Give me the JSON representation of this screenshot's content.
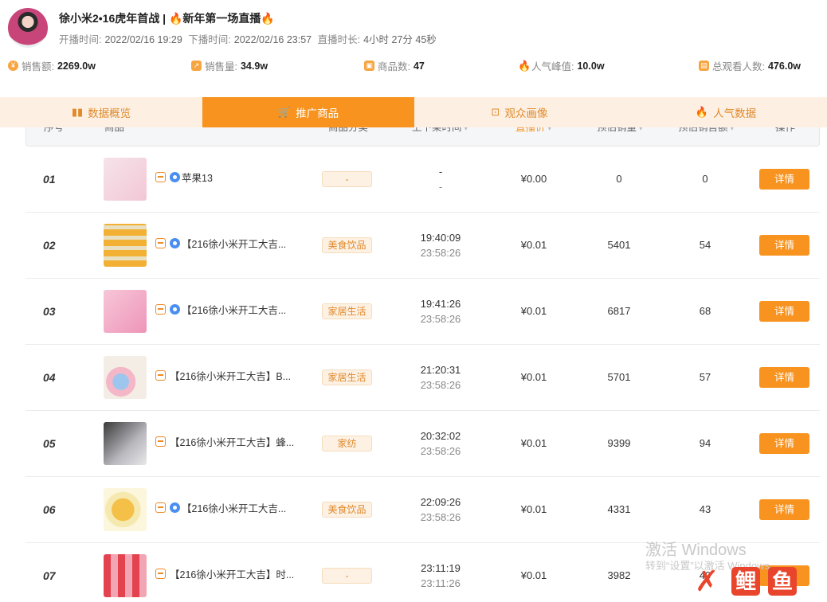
{
  "stream": {
    "title": "徐小米2•16虎年首战 |",
    "title_suffix": "新年第一场直播",
    "start_label": "开播时间:",
    "start_value": "2022/02/16 19:29",
    "end_label": "下播时间:",
    "end_value": "2022/02/16 23:57",
    "duration_label": "直播时长:",
    "duration_value": "4小时 27分 45秒"
  },
  "stats": [
    {
      "label": "销售额:",
      "value": "2269.0w",
      "icon": "coin-icon"
    },
    {
      "label": "销售量:",
      "value": "34.9w",
      "icon": "trend-chart-icon"
    },
    {
      "label": "商品数:",
      "value": "47",
      "icon": "bag-icon"
    },
    {
      "label": "人气峰值:",
      "value": "10.0w",
      "icon": "flame-icon"
    },
    {
      "label": "总观看人数:",
      "value": "476.0w",
      "icon": "gift-icon"
    }
  ],
  "tabs": [
    {
      "label": "数据概览",
      "icon": "bar-chart-icon",
      "active": false
    },
    {
      "label": "推广商品",
      "icon": "basket-icon",
      "active": true
    },
    {
      "label": "观众画像",
      "icon": "scan-icon",
      "active": false
    },
    {
      "label": "人气数据",
      "icon": "flame-icon",
      "active": false
    }
  ],
  "table": {
    "headers": {
      "index": "序号",
      "product": "商品",
      "category": "商品分类",
      "time": "上下架时间",
      "price": "直播价",
      "sales": "预估销量",
      "amount": "预估销售额",
      "action": "操作"
    },
    "rows": [
      {
        "index": "01",
        "name": "苹果13",
        "tag": true,
        "badge": true,
        "category": "-",
        "time_on": "-",
        "time_off": "-",
        "price": "¥0.00",
        "sales": "0",
        "amount": "0",
        "action": "详情"
      },
      {
        "index": "02",
        "name": "【216徐小米开工大吉...",
        "tag": true,
        "badge": true,
        "category": "美食饮品",
        "time_on": "19:40:09",
        "time_off": "23:58:26",
        "price": "¥0.01",
        "sales": "5401",
        "amount": "54",
        "action": "详情"
      },
      {
        "index": "03",
        "name": "【216徐小米开工大吉...",
        "tag": true,
        "badge": true,
        "category": "家居生活",
        "time_on": "19:41:26",
        "time_off": "23:58:26",
        "price": "¥0.01",
        "sales": "6817",
        "amount": "68",
        "action": "详情"
      },
      {
        "index": "04",
        "name": "【216徐小米开工大吉】B...",
        "tag": true,
        "badge": false,
        "category": "家居生活",
        "time_on": "21:20:31",
        "time_off": "23:58:26",
        "price": "¥0.01",
        "sales": "5701",
        "amount": "57",
        "action": "详情"
      },
      {
        "index": "05",
        "name": "【216徐小米开工大吉】蜂...",
        "tag": true,
        "badge": false,
        "category": "家纺",
        "time_on": "20:32:02",
        "time_off": "23:58:26",
        "price": "¥0.01",
        "sales": "9399",
        "amount": "94",
        "action": "详情"
      },
      {
        "index": "06",
        "name": "【216徐小米开工大吉...",
        "tag": true,
        "badge": true,
        "category": "美食饮品",
        "time_on": "22:09:26",
        "time_off": "23:58:26",
        "price": "¥0.01",
        "sales": "4331",
        "amount": "43",
        "action": "详情"
      },
      {
        "index": "07",
        "name": "【216徐小米开工大吉】时...",
        "tag": true,
        "badge": false,
        "category": "-",
        "time_on": "23:11:19",
        "time_off": "23:11:26",
        "price": "¥0.01",
        "sales": "3982",
        "amount": "40",
        "action": "详情"
      }
    ]
  },
  "watermark": {
    "line1": "激活 Windows",
    "line2": "转到“设置”以激活 Windows。"
  },
  "logo": {
    "text": "X 鲤 鱼"
  }
}
